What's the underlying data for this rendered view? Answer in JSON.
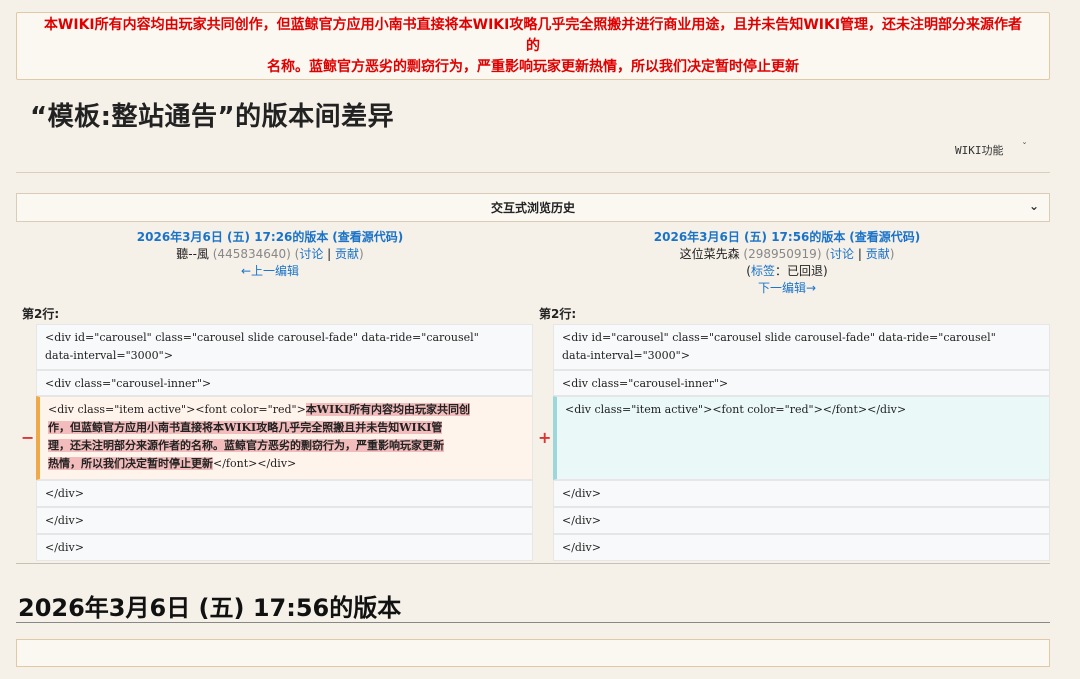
{
  "notice": {
    "line1": "本WIKI所有内容均由玩家共同创作，但蓝鲸官方应用小南书直接将本WIKI攻略几乎完全照搬并进行商业用途，且并未告知WIKI管理，还未注明部分来源作者的",
    "line2": "名称。蓝鲸官方恶劣的剽窃行为，严重影响玩家更新热情，所以我们决定暂时停止更新"
  },
  "page_title": "“模板:整站通告”的版本间差异",
  "wiki_func": {
    "label": "WIKI功能",
    "icon": "chevron-down-icon"
  },
  "history_label": "交互式浏览历史",
  "left_rev": {
    "version": "2026年3月6日 (五) 17:26的版本",
    "view_source": "(查看源代码)",
    "user": "聽--風",
    "user_id": "(445834640)",
    "talk": "讨论",
    "contrib": "贡献",
    "prev_edit": "←上一编辑"
  },
  "right_rev": {
    "version": "2026年3月6日 (五) 17:56的版本",
    "view_source": "(查看源代码)",
    "user": "这位菜先森",
    "user_id": "(298950919)",
    "talk": "讨论",
    "contrib": "贡献",
    "tag_label": "标签",
    "tag_value": "已回退",
    "next_edit": "下一编辑→"
  },
  "line_label": "第2行:",
  "diff": {
    "ctx1_a": "<div id=\"carousel\" class=\"carousel slide carousel-fade\" data-ride=\"carousel\"",
    "ctx1_b": "data-interval=\"3000\">",
    "ctx2": "<div class=\"carousel-inner\">",
    "del_prefix": "<div class=\"item active\"><font color=\"red\">",
    "del_hl1": "本WIKI所有内容均由玩家共同创",
    "del_hl2": "作，但蓝鲸官方应用小南书直接将本WIKI攻略几乎完全照搬且并未告知WIKI管",
    "del_hl3": "理，还未注明部分来源作者的名称。蓝鲸官方恶劣的剽窃行为，严重影响玩家更新",
    "del_hl4": "热情，所以我们决定暂时停止更新",
    "del_suffix": "</font></div>",
    "add_line": "<div class=\"item active\"><font color=\"red\"></font></div>",
    "close_div": "</div>",
    "minus": "−",
    "plus": "+"
  },
  "version_title": "2026年3月6日 (五) 17:56的版本"
}
